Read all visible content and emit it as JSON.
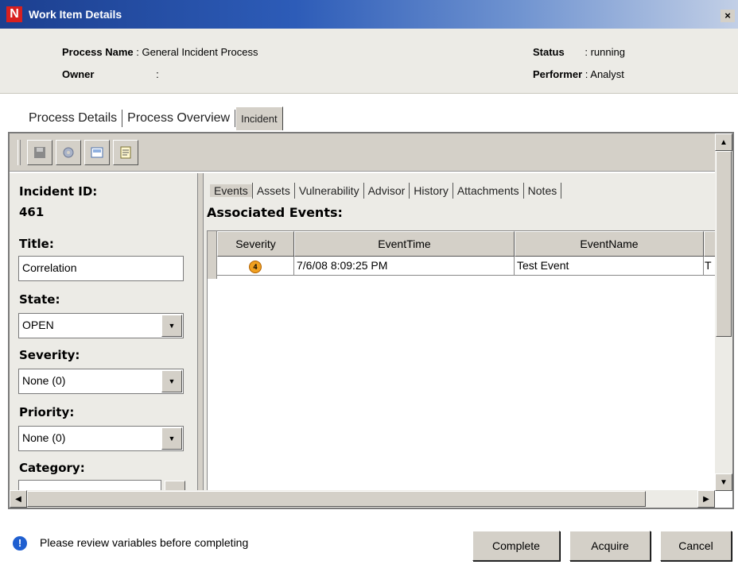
{
  "window": {
    "title": "Work Item Details",
    "logo_letter": "N",
    "close_glyph": "×"
  },
  "header": {
    "process_name_label": "Process Name",
    "process_name_value": ": General Incident Process",
    "owner_label": "Owner",
    "owner_value": ":",
    "status_label": "Status",
    "status_value": ": running",
    "performer_label": "Performer",
    "performer_value": ": Analyst"
  },
  "main_tabs": [
    {
      "label": "Process Details",
      "active": false
    },
    {
      "label": "Process Overview",
      "active": false
    },
    {
      "label": "Incident",
      "active": true
    }
  ],
  "toolbar": {
    "icons": [
      "save-icon",
      "gear-icon",
      "card-icon",
      "document-icon"
    ]
  },
  "incident": {
    "id_label": "Incident ID:",
    "id_value": "461",
    "title_label": "Title:",
    "title_value": "Correlation",
    "state_label": "State:",
    "state_value": "OPEN",
    "severity_label": "Severity:",
    "severity_value": "None (0)",
    "priority_label": "Priority:",
    "priority_value": "None (0)",
    "category_label": "Category:"
  },
  "sub_tabs": [
    {
      "label": "Events",
      "active": true
    },
    {
      "label": "Assets",
      "active": false
    },
    {
      "label": "Vulnerability",
      "active": false
    },
    {
      "label": "Advisor",
      "active": false
    },
    {
      "label": "History",
      "active": false
    },
    {
      "label": "Attachments",
      "active": false
    },
    {
      "label": "Notes",
      "active": false
    }
  ],
  "events": {
    "heading": "Associated Events:",
    "columns": [
      "Severity",
      "EventTime",
      "EventName"
    ],
    "rows": [
      {
        "severity": "4",
        "event_time": "7/6/08 8:09:25 PM",
        "event_name": "Test Event",
        "extra": "T"
      }
    ]
  },
  "footer": {
    "message": "Please review variables before completing",
    "complete_label": "Complete",
    "acquire_label": "Acquire",
    "cancel_label": "Cancel"
  },
  "colors": {
    "title_bar": "#2d5cb8",
    "panel_bg": "#ecebe6",
    "button_bg": "#d4d0c8",
    "info_blue": "#1f5fd0",
    "severity_orange": "#f0a020"
  }
}
